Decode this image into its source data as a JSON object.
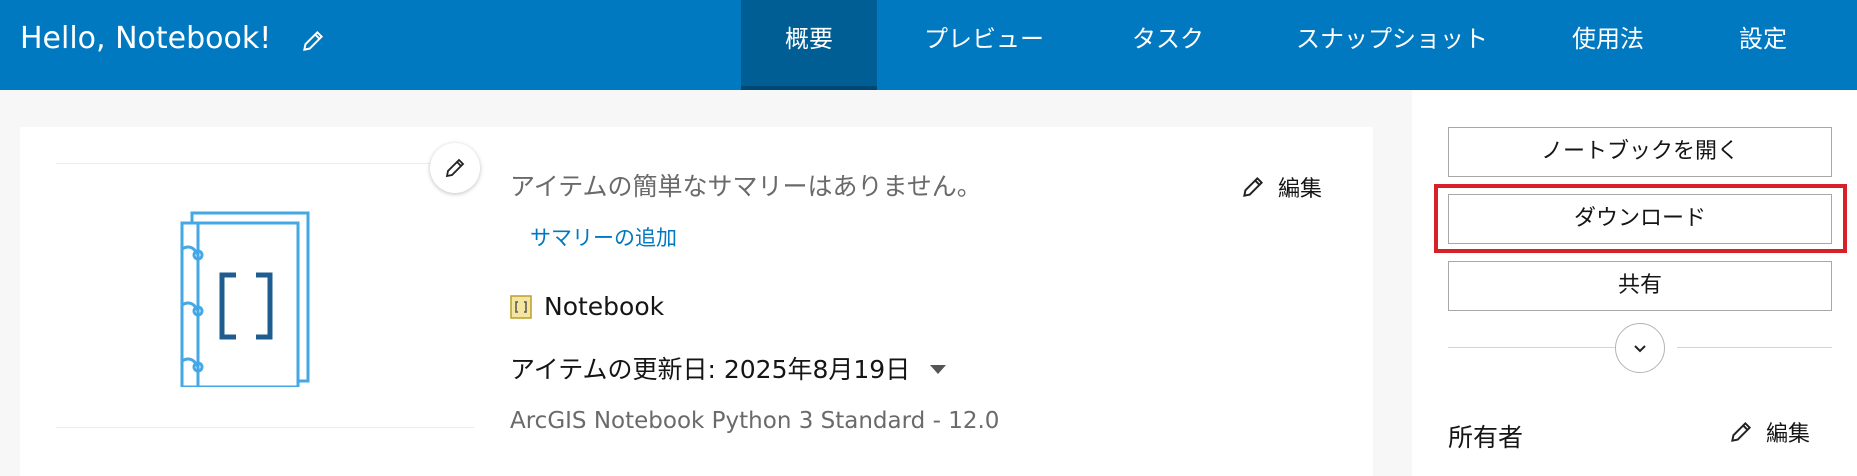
{
  "header": {
    "title": "Hello, Notebook!",
    "tabs": [
      {
        "label": "概要",
        "active": true
      },
      {
        "label": "プレビュー",
        "active": false
      },
      {
        "label": "タスク",
        "active": false
      },
      {
        "label": "スナップショット",
        "active": false
      },
      {
        "label": "使用法",
        "active": false
      },
      {
        "label": "設定",
        "active": false
      }
    ]
  },
  "summary": {
    "empty_text": "アイテムの簡単なサマリーはありません。",
    "add_link": "サマリーの追加",
    "edit_label": "編集"
  },
  "item": {
    "type_label": "Notebook",
    "updated_text": "アイテムの更新日: 2025年8月19日",
    "runtime": "ArcGIS Notebook Python 3 Standard - 12.0"
  },
  "actions": {
    "open_notebook": "ノートブックを開く",
    "download": "ダウンロード",
    "share": "共有"
  },
  "owner": {
    "label": "所有者",
    "edit_label": "編集"
  },
  "colors": {
    "brand": "#0079c1",
    "active_tab": "#005e95",
    "highlight": "#d6202a",
    "thumbnail": "#45a8e6"
  },
  "icons": {
    "title_edit": "pencil-icon",
    "thumbnail": "notebook-icon",
    "type": "notebook-type-icon",
    "expand": "chevron-down-icon"
  }
}
